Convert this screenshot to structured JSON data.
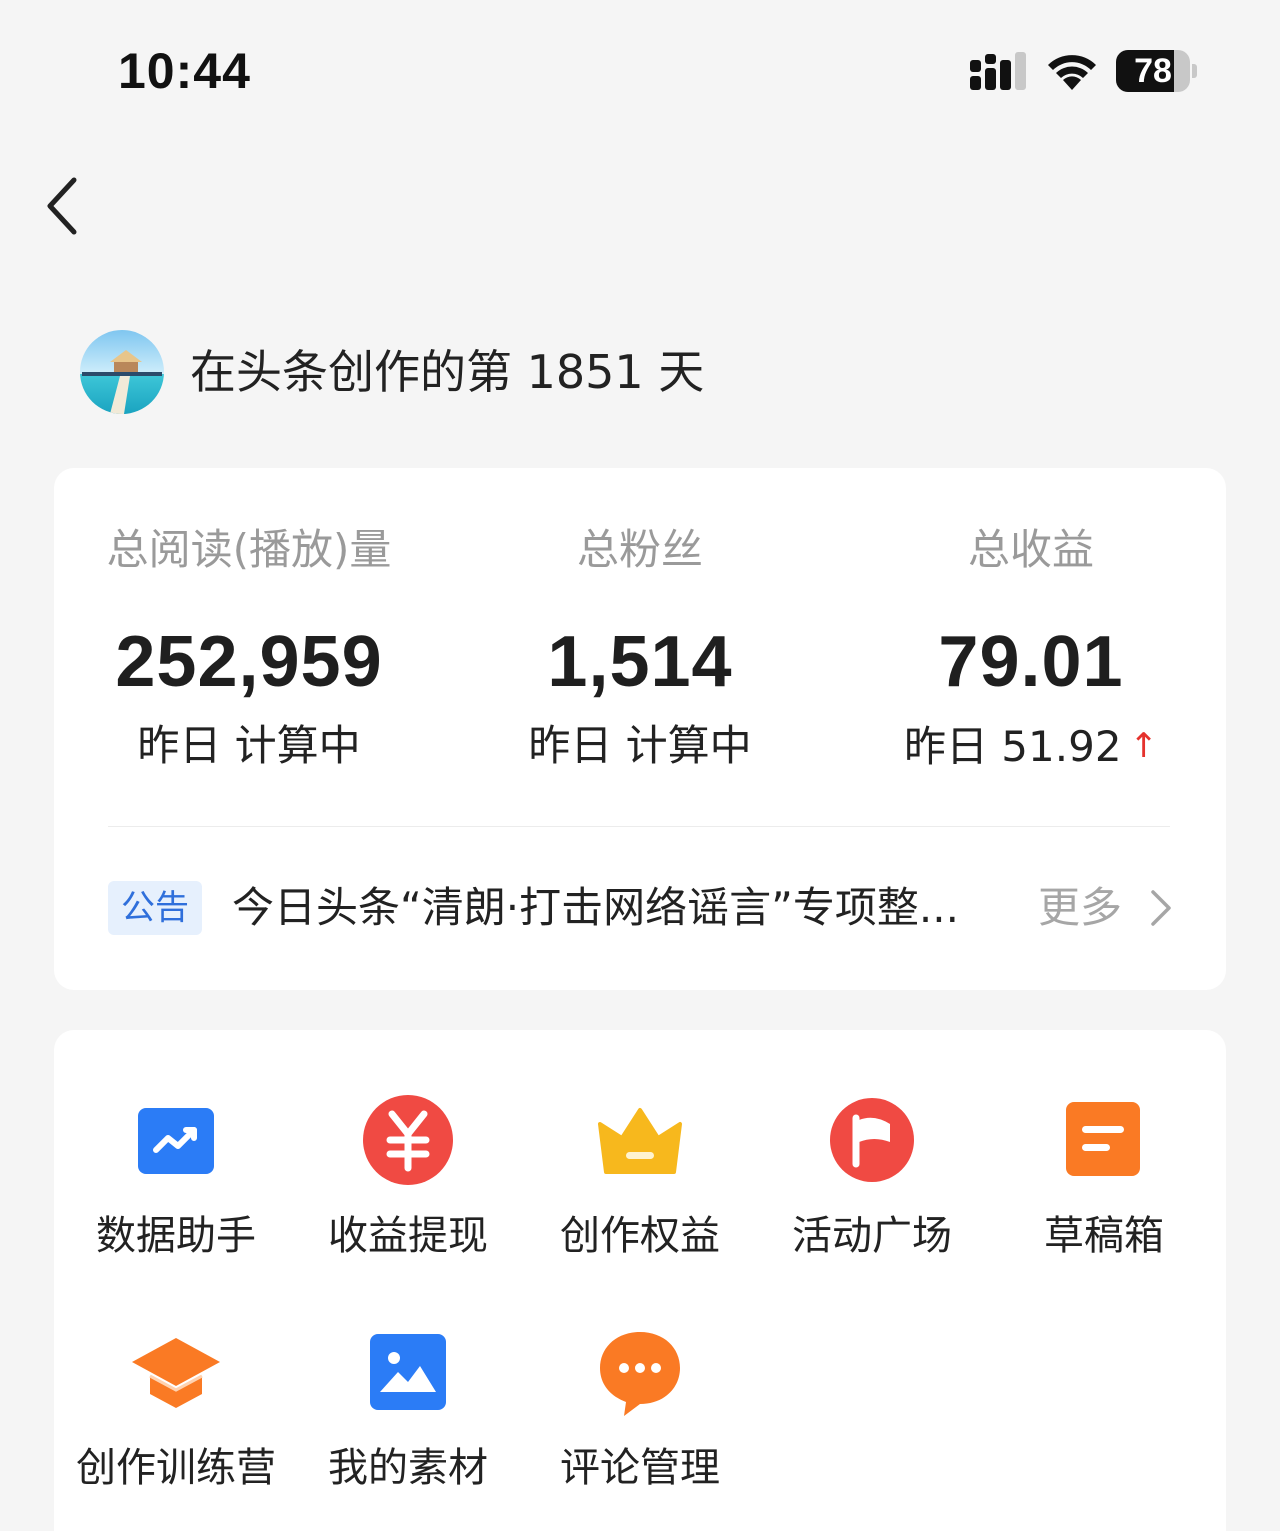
{
  "status_bar": {
    "time": "10:44",
    "battery_level": "78",
    "battery_fraction": 0.78,
    "icons": [
      "signal-icon",
      "wifi-icon",
      "battery-icon"
    ]
  },
  "nav": {
    "back_icon": "chevron-left-icon"
  },
  "profile": {
    "creation_days": "在头条创作的第 1851 天"
  },
  "stats": [
    {
      "label": "总阅读(播放)量",
      "value": "252,959",
      "yesterday": "昨日 计算中"
    },
    {
      "label": "总粉丝",
      "value": "1,514",
      "yesterday": "昨日 计算中"
    },
    {
      "label": "总收益",
      "value": "79.01",
      "yesterday": "昨日 51.92",
      "trend": "↑"
    }
  ],
  "notice": {
    "badge": "公告",
    "text": "今日头条“清朗·打击网络谣言”专项整...",
    "more": "更多"
  },
  "tools": [
    {
      "label": "数据助手",
      "icon": "chart-icon",
      "color": "#2b7cf6"
    },
    {
      "label": "收益提现",
      "icon": "yuan-icon",
      "color": "#f04a43"
    },
    {
      "label": "创作权益",
      "icon": "crown-icon",
      "color": "#f7b81d"
    },
    {
      "label": "活动广场",
      "icon": "flag-icon",
      "color": "#f04a43"
    },
    {
      "label": "草稿箱",
      "icon": "draft-icon",
      "color": "#fa7a24"
    },
    {
      "label": "创作训练营",
      "icon": "graduation-cap-icon",
      "color": "#fa7a24"
    },
    {
      "label": "我的素材",
      "icon": "image-icon",
      "color": "#2b7cf6"
    },
    {
      "label": "评论管理",
      "icon": "comment-icon",
      "color": "#fa7a24"
    }
  ],
  "colors": {
    "background": "#f5f5f5",
    "card": "#ffffff",
    "accent_blue": "#2f6fdb",
    "trend_red": "#e5322d"
  }
}
